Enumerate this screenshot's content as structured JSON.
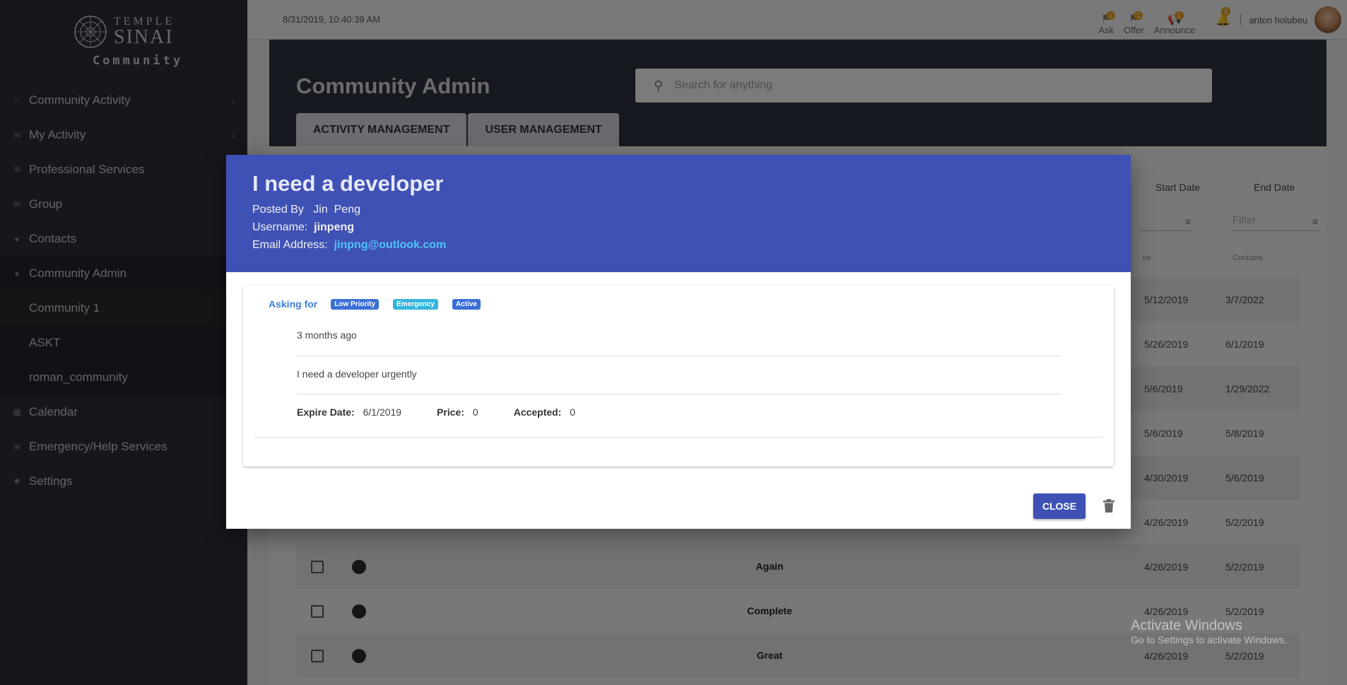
{
  "brand": {
    "line1": "TEMPLE",
    "line2": "SINAI",
    "line3": "Community"
  },
  "sidebar": {
    "items": [
      {
        "label": "Community Activity",
        "icon": "home-icon"
      },
      {
        "label": "My Activity",
        "icon": "mail-icon"
      },
      {
        "label": "Professional Services",
        "icon": "mail-icon"
      },
      {
        "label": "Group",
        "icon": "mail-icon"
      },
      {
        "label": "Contacts",
        "icon": "person-icon"
      },
      {
        "label": "Community Admin",
        "icon": "chat-icon"
      },
      {
        "label": "Community 1"
      },
      {
        "label": "ASKT"
      },
      {
        "label": "roman_community"
      },
      {
        "label": "Calendar",
        "icon": "calendar-icon"
      },
      {
        "label": "Emergency/Help Services",
        "icon": "help-icon"
      },
      {
        "label": "Settings",
        "icon": "gear-icon"
      }
    ]
  },
  "topbar": {
    "timestamp": "8/31/2019, 10:40:39 AM",
    "actions": [
      {
        "label": "Ask",
        "badge": "1"
      },
      {
        "label": "Offer",
        "badge": "1"
      },
      {
        "label": "Announce",
        "badge": "1"
      }
    ],
    "notifications": "5",
    "separator": "|",
    "username": "anton holubeu"
  },
  "page": {
    "title": "Community Admin",
    "search_placeholder": "Search for anything",
    "tabs": [
      "ACTIVITY MANAGEMENT",
      "USER MANAGEMENT"
    ]
  },
  "table": {
    "col_start": "Start Date",
    "col_end": "End Date",
    "filter_placeholder": "Filter",
    "filter_mode_partial": "ns",
    "filter_mode": "Contains",
    "rows": [
      {
        "start": "5/12/2019",
        "end": "3/7/2022",
        "title": ""
      },
      {
        "start": "5/26/2019",
        "end": "6/1/2019",
        "title": ""
      },
      {
        "start": "5/6/2019",
        "end": "1/29/2022",
        "title": ""
      },
      {
        "start": "5/6/2019",
        "end": "5/8/2019",
        "title": ""
      },
      {
        "start": "4/30/2019",
        "end": "5/6/2019",
        "title": ""
      },
      {
        "start": "4/26/2019",
        "end": "5/2/2019",
        "title": ""
      },
      {
        "start": "4/26/2019",
        "end": "5/2/2019",
        "title": "Again"
      },
      {
        "start": "4/26/2019",
        "end": "5/2/2019",
        "title": "Complete"
      },
      {
        "start": "4/26/2019",
        "end": "5/2/2019",
        "title": "Great"
      }
    ]
  },
  "dialog": {
    "title": "I need a developer",
    "posted_by_label": "Posted By",
    "posted_by": "Jin  Peng",
    "username_label": "Username:",
    "username": "jinpeng",
    "email_label": "Email Address:",
    "email": "jinpng@outlook.com",
    "asking_for": "Asking for",
    "chips": [
      "Low Priority",
      "Emergency",
      "Active"
    ],
    "time_ago": "3 months ago",
    "description": "I need a developer urgently",
    "expire_label": "Expire Date:",
    "expire": "6/1/2019",
    "price_label": "Price:",
    "price": "0",
    "accepted_label": "Accepted:",
    "accepted": "0",
    "close_label": "CLOSE"
  },
  "watermark": {
    "line1": "Activate Windows",
    "line2": "Go to Settings to activate Windows."
  }
}
